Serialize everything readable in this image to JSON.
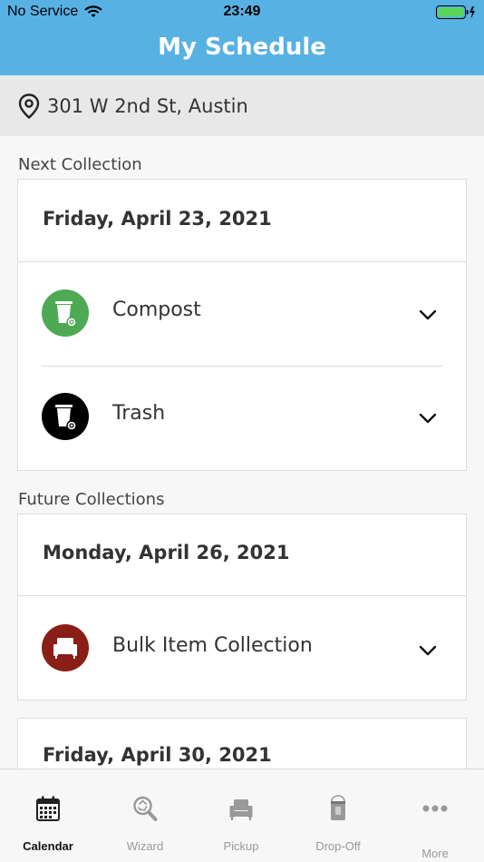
{
  "status_bar": {
    "carrier": "No Service",
    "time": "23:49",
    "battery_color": "#5bd45b"
  },
  "header": {
    "title": "My Schedule",
    "background_color": "#58b1e3"
  },
  "address": {
    "text": "301 W 2nd St, Austin",
    "icon": "location-pin-icon"
  },
  "next_collection": {
    "label": "Next Collection",
    "date": "Friday, April 23, 2021",
    "items": [
      {
        "label": "Compost",
        "icon": "compost-cart-icon",
        "color": "#4ea954"
      },
      {
        "label": "Trash",
        "icon": "trash-cart-icon",
        "color": "#000000"
      }
    ]
  },
  "future_collections": {
    "label": "Future Collections",
    "groups": [
      {
        "date": "Monday, April 26, 2021",
        "items": [
          {
            "label": "Bulk Item Collection",
            "icon": "armchair-icon",
            "color": "#8a1f17"
          }
        ]
      },
      {
        "date": "Friday, April 30, 2021",
        "items": []
      }
    ]
  },
  "tab_bar": {
    "tabs": [
      {
        "label": "Calendar",
        "icon": "calendar-icon",
        "active": true
      },
      {
        "label": "Wizard",
        "icon": "recycle-search-icon",
        "active": false
      },
      {
        "label": "Pickup",
        "icon": "armchair-icon",
        "active": false
      },
      {
        "label": "Drop-Off",
        "icon": "paint-can-icon",
        "active": false
      },
      {
        "label": "More",
        "icon": "more-dots-icon",
        "active": false
      }
    ]
  }
}
